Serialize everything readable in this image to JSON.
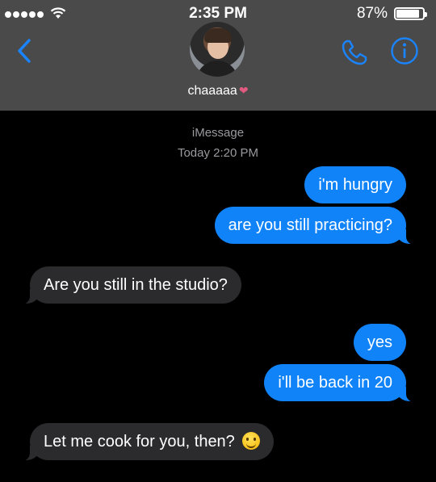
{
  "status_bar": {
    "signal_dots": 5,
    "time": "2:35 PM",
    "battery_percent": "87%",
    "battery_level": 0.87
  },
  "header": {
    "back_icon": "chevron-left-icon",
    "contact_name": "chaaaaa",
    "contact_emoji": "anatomical-heart-emoji",
    "phone_icon": "phone-icon",
    "info_icon": "info-icon"
  },
  "thread": {
    "service": "iMessage",
    "timestamp": "Today 2:20 PM"
  },
  "messages": [
    {
      "direction": "sent",
      "text": "i'm hungry"
    },
    {
      "direction": "sent",
      "text": "are you still practicing?"
    },
    {
      "direction": "received",
      "text": "Are you still in the studio?"
    },
    {
      "direction": "sent",
      "text": "yes"
    },
    {
      "direction": "sent",
      "text": "i'll be back in 20"
    },
    {
      "direction": "received",
      "text": "Let me cook for you, then?",
      "emoji": "smiling-face-emoji"
    }
  ],
  "colors": {
    "header_bg": "#4a4a4a",
    "sent_bubble": "#1183f8",
    "received_bubble": "#2b2b2d",
    "accent": "#1a84ff"
  }
}
